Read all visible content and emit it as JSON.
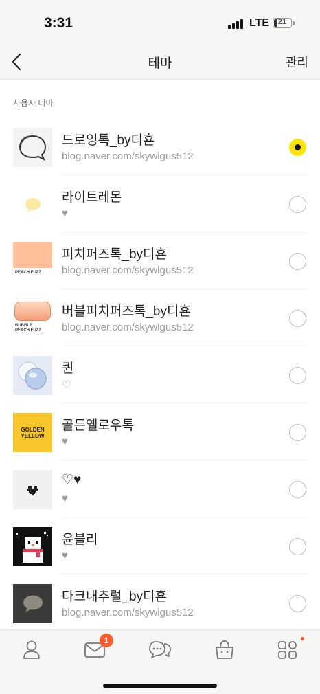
{
  "status_bar": {
    "time": "3:31",
    "network": "LTE",
    "battery": "21",
    "battery_level": 0.21
  },
  "nav": {
    "title": "테마",
    "manage_label": "관리",
    "back_icon": "chevron-left-icon"
  },
  "section": {
    "label": "사용자 테마"
  },
  "themes": [
    {
      "name": "드로잉톡_by디횬",
      "subtitle": "blog.naver.com/skywlgus512",
      "selected": true
    },
    {
      "name": "라이트레몬",
      "subtitle": "♥",
      "selected": false
    },
    {
      "name": "피치퍼즈톡_by디횬",
      "subtitle": "blog.naver.com/skywlgus512",
      "selected": false,
      "thumb_text": "PEACH FUZZ"
    },
    {
      "name": "버블피치퍼즈톡_by디횬",
      "subtitle": "blog.naver.com/skywlgus512",
      "selected": false,
      "thumb_text_1": "BUBBLE",
      "thumb_text_2": "PEACH FUZZ"
    },
    {
      "name": "퀸",
      "subtitle": "♡",
      "selected": false
    },
    {
      "name": "골든옐로우톡",
      "subtitle": "♥",
      "selected": false,
      "thumb_text_1": "GOLDEN",
      "thumb_text_2": "YELLOW"
    },
    {
      "name": "♡♥",
      "subtitle": "♥",
      "selected": false
    },
    {
      "name": "윤블리",
      "subtitle": "♥",
      "selected": false
    },
    {
      "name": "다크내추럴_by디횬",
      "subtitle": "blog.naver.com/skywlgus512",
      "selected": false
    }
  ],
  "tab_bar": {
    "items": [
      "friends-icon",
      "chats-icon",
      "openchat-icon",
      "shopping-icon",
      "more-icon"
    ],
    "chat_badge": "1"
  },
  "colors": {
    "accent": "#fee500",
    "badge": "#ff5a2a",
    "peach": "#ffbf98",
    "golden": "#f8c52a"
  }
}
